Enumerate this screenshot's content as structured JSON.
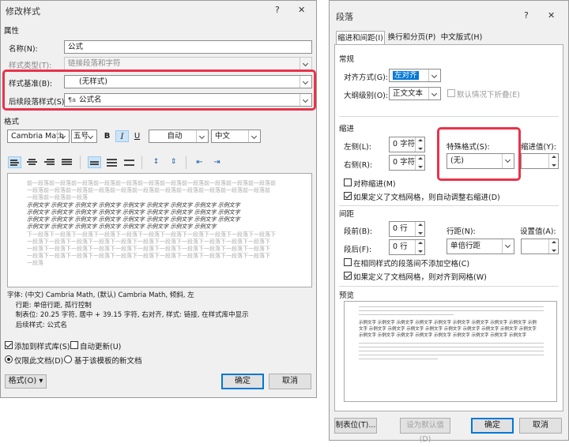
{
  "modify_style": {
    "title": "修改样式",
    "help": "?",
    "close": "✕",
    "properties_heading": "属性",
    "name_label": "名称(N):",
    "name_value": "公式",
    "type_label": "样式类型(T):",
    "type_value": "链接段落和字符",
    "based_on_label": "样式基准(B):",
    "based_on_value": "(无样式)",
    "following_label": "后续段落样式(S):",
    "following_glyph": "¶a",
    "following_value": "公式名",
    "format_heading": "格式",
    "font_value": "Cambria Math",
    "size_value": "五号",
    "bold": "B",
    "italic": "I",
    "underline": "U",
    "color_value": "自动",
    "script_value": "中文",
    "preview_prev": [
      "前一段落前一段落前一段落前一段落前一段落前一段落前一段落前一段落前一段落前一段落前一段落前",
      "一段落前一段落前一段落前一段落前一段落前一段落前一段落前一段落前一段落前一段落前一段落前",
      "一段落前一段落前一段落"
    ],
    "preview_sample": [
      "示例文字 示例文字 示例文字 示例文字 示例文字 示例文字 示例文字 示例文字 示例文字",
      "示例文字 示例文字 示例文字 示例文字 示例文字 示例文字 示例文字 示例文字 示例文字",
      "示例文字 示例文字 示例文字 示例文字 示例文字 示例文字 示例文字 示例文字 示例文字",
      "示例文字 示例文字 示例文字 示例文字 示例文字 示例文字 示例文字 示例文字"
    ],
    "preview_next": [
      "下一段落下一段落下一段落下一段落下一段落下一段落下一段落下一段落下一段落下一段落下一段落下",
      "一段落下一段落下一段落下一段落下一段落下一段落下一段落下一段落下一段落下一段落下一段落下",
      "一段落下一段落下一段落下一段落下一段落下一段落下一段落下一段落下一段落下一段落下一段落下",
      "一段落下一段落下一段落下一段落下一段落下一段落下一段落下一段落下一段落下一段落下一段落下",
      "一段落"
    ],
    "description": [
      "字体: (中文) Cambria Math, (默认) Cambria Math, 倾斜, 左",
      "    行距: 单倍行距, 孤行控制",
      "    制表位: 20.25 字符, 居中 + 39.15 字符, 右对齐, 样式: 链接, 在样式库中显示",
      "    后续样式: 公式名"
    ],
    "add_to_gallery": "添加到样式库(S)",
    "auto_update": "自动更新(U)",
    "only_this_doc": "仅限此文档(D)",
    "new_docs": "基于该模板的新文档",
    "format_button": "格式(O) ▾",
    "ok": "确定",
    "cancel": "取消"
  },
  "paragraph": {
    "title": "段落",
    "help": "?",
    "close": "✕",
    "tabs": [
      "缩进和间距(I)",
      "换行和分页(P)",
      "中文版式(H)"
    ],
    "general_heading": "常规",
    "alignment_label": "对齐方式(G):",
    "alignment_value": "左对齐",
    "outline_label": "大纲级别(O):",
    "outline_value": "正文文本",
    "collapsed_default": "默认情况下折叠(E)",
    "indent_heading": "缩进",
    "left_label": "左侧(L):",
    "left_value": "0 字符",
    "right_label": "右侧(R):",
    "right_value": "0 字符",
    "special_label": "特殊格式(S):",
    "special_value": "(无)",
    "indent_value_label": "缩进值(Y):",
    "mirror_indent": "对称缩进(M)",
    "auto_adjust_right": "如果定义了文档网格，则自动调整右缩进(D)",
    "spacing_heading": "间距",
    "before_label": "段前(B):",
    "before_value": "0 行",
    "after_label": "段后(F):",
    "after_value": "0 行",
    "line_spacing_label": "行距(N):",
    "line_spacing_value": "单倍行距",
    "setting_label": "设置值(A):",
    "no_space_same_style": "在相同样式的段落间不添加空格(C)",
    "snap_to_grid": "如果定义了文档网格，则对齐到网格(W)",
    "preview_heading": "预览",
    "preview_sample": [
      "示例文字 示例文字 示例文字 示例文字 示例文字 示例文字 示例文字 示例文字 示例文字 示例",
      "文字 示例文字 示例文字 示例文字 示例文字 示例文字 示例文字 示例文字 示例文字 示例文字",
      "示例文字 示例文字 示例文字 示例文字 示例文字 示例文字 示例文字 示例文字 示例文字"
    ],
    "tabs_button": "制表位(T)...",
    "default_button": "设为默认值(D)",
    "ok": "确定",
    "cancel": "取消"
  },
  "colors": {
    "accent": "#0078d7",
    "highlight": "#e8334a"
  }
}
